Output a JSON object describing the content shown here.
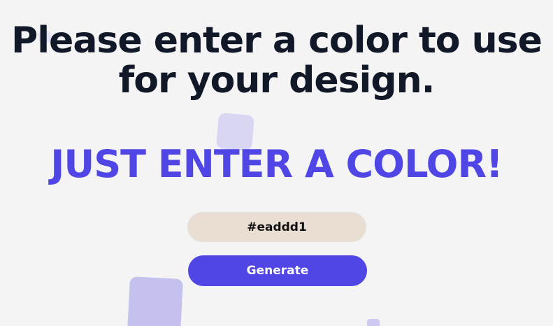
{
  "heading": {
    "title": "Please enter a color to use for your design.",
    "tagline": "JUST ENTER A COLOR!"
  },
  "form": {
    "color_value": "#eaddd1",
    "generate_label": "Generate"
  },
  "colors": {
    "background": "#f4f4f5",
    "title_text": "#111827",
    "accent": "#4f46e5",
    "input_background": "#eaddd1"
  }
}
